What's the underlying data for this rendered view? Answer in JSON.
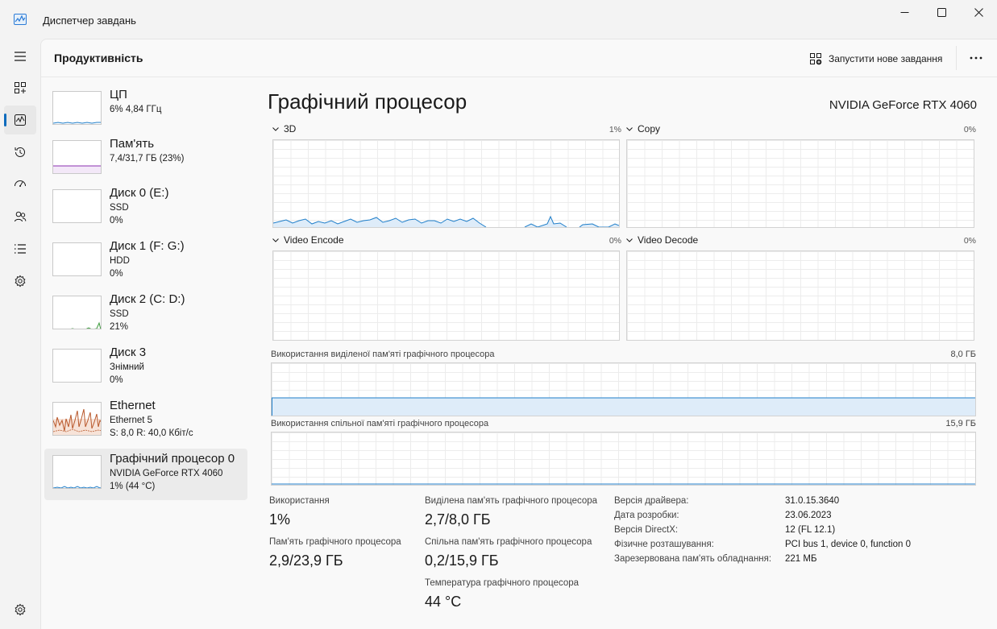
{
  "window": {
    "title": "Диспетчер завдань",
    "controls": {
      "minimize": "—",
      "maximize": "☐",
      "close": "✕"
    }
  },
  "nav": {
    "items": [
      {
        "name": "menu",
        "icon": "hamburger-icon"
      },
      {
        "name": "processes",
        "icon": "processes-icon"
      },
      {
        "name": "performance",
        "icon": "performance-icon",
        "active": true
      },
      {
        "name": "app-history",
        "icon": "history-icon"
      },
      {
        "name": "startup",
        "icon": "startup-icon"
      },
      {
        "name": "users",
        "icon": "users-icon"
      },
      {
        "name": "details",
        "icon": "details-icon"
      },
      {
        "name": "services",
        "icon": "services-icon"
      }
    ],
    "settings_icon": "settings-icon"
  },
  "header": {
    "title": "Продуктивність",
    "run_task_label": "Запустити нове завдання",
    "more_icon": "ellipsis-icon"
  },
  "devices": [
    {
      "name": "ЦП",
      "line1": "6%  4,84 ГГц",
      "line2": "",
      "color": "#1f7ec9"
    },
    {
      "name": "Пам'ять",
      "line1": "7,4/31,7 ГБ (23%)",
      "line2": "",
      "color": "#8b2fb0"
    },
    {
      "name": "Диск 0 (E:)",
      "line1": "SSD",
      "line2": "0%",
      "color": "#3c9a3c"
    },
    {
      "name": "Диск 1 (F: G:)",
      "line1": "HDD",
      "line2": "0%",
      "color": "#3c9a3c"
    },
    {
      "name": "Диск 2 (C: D:)",
      "line1": "SSD",
      "line2": "21%",
      "color": "#3c9a3c"
    },
    {
      "name": "Диск 3",
      "line1": "Знімний",
      "line2": "0%",
      "color": "#3c9a3c"
    },
    {
      "name": "Ethernet",
      "line1": "Ethernet 5",
      "line2": "S: 8,0  R: 40,0 Кбіт/с",
      "color": "#b8572a"
    },
    {
      "name": "Графічний процесор 0",
      "line1": "NVIDIA GeForce RTX 4060",
      "line2": "1%  (44 °C)",
      "color": "#1f7ec9",
      "selected": true
    }
  ],
  "detail": {
    "title": "Графічний процесор",
    "model": "NVIDIA GeForce RTX 4060",
    "engines": [
      {
        "label": "3D",
        "percent": "1%"
      },
      {
        "label": "Copy",
        "percent": "0%"
      },
      {
        "label": "Video Encode",
        "percent": "0%"
      },
      {
        "label": "Video Decode",
        "percent": "0%"
      }
    ],
    "dedicated_mem": {
      "label": "Використання виділеної пам'яті графічного процесора",
      "max": "8,0 ГБ"
    },
    "shared_mem": {
      "label": "Використання спільної пам'яті графічного процесора",
      "max": "15,9 ГБ"
    },
    "stats": {
      "utilization": {
        "label": "Використання",
        "value": "1%"
      },
      "gpu_memory": {
        "label": "Пам'ять графічного процесора",
        "value": "2,9/23,9 ГБ"
      },
      "dedicated": {
        "label": "Виділена пам'ять графічного процесора",
        "value": "2,7/8,0 ГБ"
      },
      "shared": {
        "label": "Спільна пам'ять графічного процесора",
        "value": "0,2/15,9 ГБ"
      },
      "temperature": {
        "label": "Температура графічного процесора",
        "value": "44 °C"
      }
    },
    "info": [
      {
        "key": "Версія драйвера:",
        "value": "31.0.15.3640"
      },
      {
        "key": "Дата розробки:",
        "value": "23.06.2023"
      },
      {
        "key": "Версія DirectX:",
        "value": "12 (FL 12.1)"
      },
      {
        "key": "Фізичне розташування:",
        "value": "PCI bus 1, device 0, function 0"
      },
      {
        "key": "Зарезервована пам'ять обладнання:",
        "value": "221 МБ"
      }
    ]
  },
  "colors": {
    "accent": "#0f6cbd",
    "graph_line": "#1f7ec9",
    "graph_fill": "#deecf9"
  }
}
